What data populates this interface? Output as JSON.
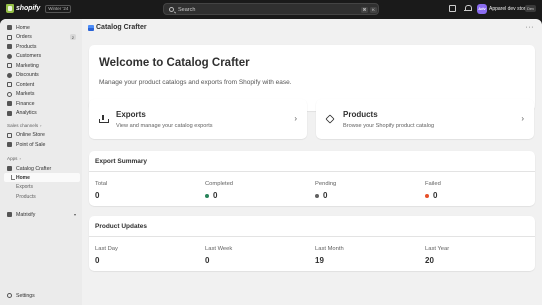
{
  "topbar": {
    "logo_text": "shopify",
    "edition": "Winter '24",
    "search_placeholder": "Search",
    "kbd1": "⌘",
    "kbd2": "K",
    "avatar_initials": "Adv",
    "store_name": "Apparel dev store",
    "store_badge": "Dev"
  },
  "sidebar": {
    "items": [
      {
        "label": "Home"
      },
      {
        "label": "Orders",
        "count": "2"
      },
      {
        "label": "Products"
      },
      {
        "label": "Customers"
      },
      {
        "label": "Marketing"
      },
      {
        "label": "Discounts"
      },
      {
        "label": "Content"
      },
      {
        "label": "Markets"
      },
      {
        "label": "Finance"
      },
      {
        "label": "Analytics"
      }
    ],
    "sales_channels_label": "Sales channels",
    "channels": [
      {
        "label": "Online Store"
      },
      {
        "label": "Point of Sale"
      }
    ],
    "apps_label": "Apps",
    "app_name": "Catalog Crafter",
    "app_subitems": [
      {
        "label": "Home"
      },
      {
        "label": "Exports"
      },
      {
        "label": "Products"
      }
    ],
    "matrixify": "Matrixify",
    "settings": "Settings"
  },
  "page": {
    "title": "Catalog Crafter",
    "welcome_title": "Welcome to Catalog Crafter",
    "welcome_desc": "Manage your product catalogs and exports from Shopify with ease.",
    "cards": [
      {
        "title": "Exports",
        "desc": "View and manage your catalog exports"
      },
      {
        "title": "Products",
        "desc": "Browse your Shopify product catalog"
      }
    ],
    "export_summary": {
      "title": "Export Summary",
      "stats": [
        {
          "label": "Total",
          "value": "0"
        },
        {
          "label": "Completed",
          "value": "0",
          "color": "#29845a"
        },
        {
          "label": "Pending",
          "value": "0",
          "color": "#616161"
        },
        {
          "label": "Failed",
          "value": "0",
          "color": "#e6502a"
        }
      ]
    },
    "product_updates": {
      "title": "Product Updates",
      "stats": [
        {
          "label": "Last Day",
          "value": "0"
        },
        {
          "label": "Last Week",
          "value": "0"
        },
        {
          "label": "Last Month",
          "value": "19"
        },
        {
          "label": "Last Year",
          "value": "20"
        }
      ]
    }
  }
}
